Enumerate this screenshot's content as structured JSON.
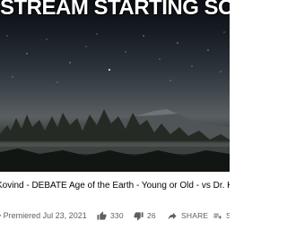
{
  "player": {
    "overlay_text": "STREAM STARTING SOON..."
  },
  "video": {
    "title": "Kovind - DEBATE Age of the Earth - Young or Old - vs Dr. Kenneth",
    "premiered_label": "• Premiered Jul 23, 2021"
  },
  "actions": {
    "like_count": "330",
    "dislike_count": "26",
    "share_label": "SHARE",
    "save_label": "S"
  },
  "colors": {
    "text_primary": "#030303",
    "text_secondary": "#606060",
    "background": "#ffffff"
  },
  "icons": {
    "like": "thumbs-up-icon",
    "dislike": "thumbs-down-icon",
    "share": "share-arrow-icon",
    "save": "playlist-add-icon"
  }
}
